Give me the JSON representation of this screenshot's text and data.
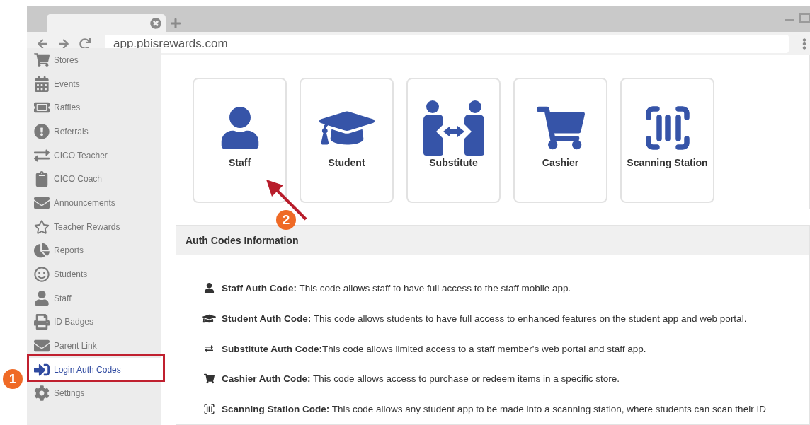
{
  "browser": {
    "url": "app.pbisrewards.com"
  },
  "sidebar": {
    "items": [
      {
        "label": "Stores",
        "selected": false
      },
      {
        "label": "Events",
        "selected": false
      },
      {
        "label": "Raffles",
        "selected": false
      },
      {
        "label": "Referrals",
        "selected": false
      },
      {
        "label": "CICO Teacher",
        "selected": false
      },
      {
        "label": "CICO Coach",
        "selected": false
      },
      {
        "label": "Announcements",
        "selected": false
      },
      {
        "label": "Teacher Rewards",
        "selected": false
      },
      {
        "label": "Reports",
        "selected": false
      },
      {
        "label": "Students",
        "selected": false
      },
      {
        "label": "Staff",
        "selected": false
      },
      {
        "label": "ID Badges",
        "selected": false
      },
      {
        "label": "Parent Link",
        "selected": false
      },
      {
        "label": "Login Auth Codes",
        "selected": true
      },
      {
        "label": "Settings",
        "selected": false
      }
    ]
  },
  "login_cards": [
    {
      "label": "Staff"
    },
    {
      "label": "Student"
    },
    {
      "label": "Substitute"
    },
    {
      "label": "Cashier"
    },
    {
      "label": "Scanning Station"
    }
  ],
  "info_panel": {
    "title": "Auth Codes Information",
    "items": [
      {
        "text": "**Staff Auth Code:** This code allows staff to have full access to the staff mobile app."
      },
      {
        "text": "**Student Auth Code:** This code allows students to have full access to enhanced features on the student app and web portal."
      },
      {
        "text": "**Substitute Auth Code:**This code allows limited access to a staff member's web portal and staff app."
      },
      {
        "text": "**Cashier Auth Code:** This code allows access to purchase or redeem items in a specific store."
      },
      {
        "text": "**Scanning Station Code:** This code allows any student app to be made into a scanning station, where students can scan their ID"
      }
    ]
  },
  "annotations": [
    {
      "label": "1"
    },
    {
      "label": "2"
    }
  ]
}
